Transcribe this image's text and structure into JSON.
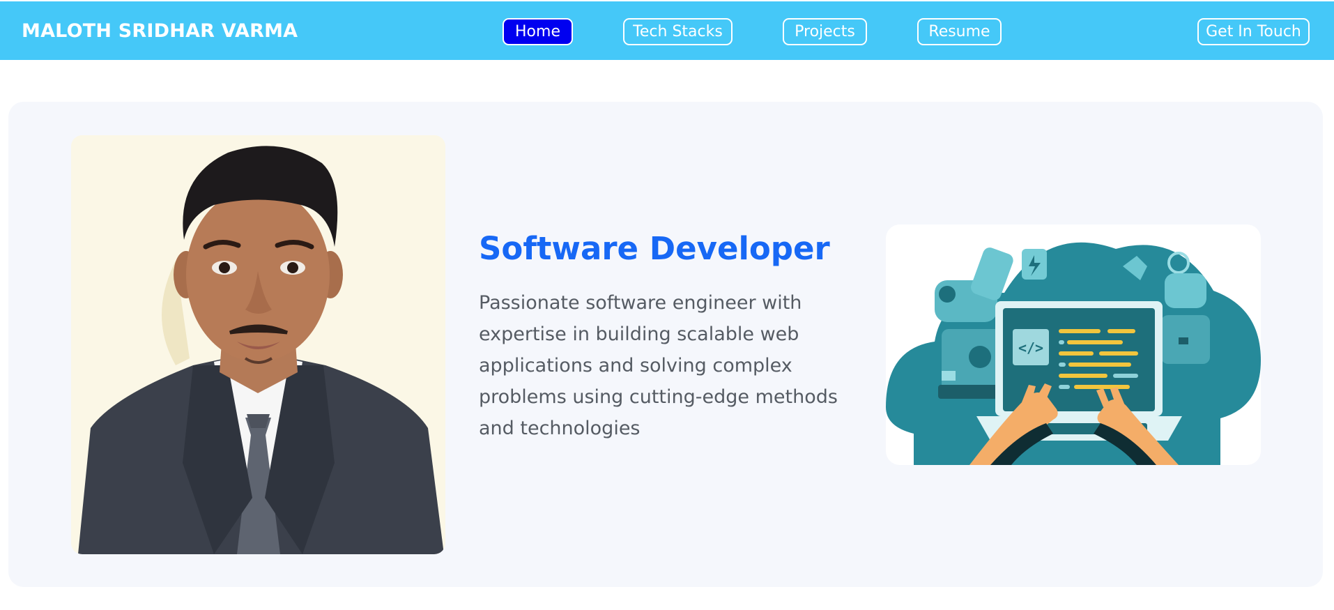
{
  "navbar": {
    "brand": "MALOTH SRIDHAR VARMA",
    "links": [
      {
        "label": "Home",
        "active": true
      },
      {
        "label": "Tech Stacks",
        "active": false
      },
      {
        "label": "Projects",
        "active": false
      },
      {
        "label": "Resume",
        "active": false
      }
    ],
    "cta_label": "Get In Touch"
  },
  "hero": {
    "title": "Software Developer",
    "description": "Passionate software engineer with expertise in building scalable web applications and solving complex problems using cutting-edge methods and technologies",
    "illustration_code_label": "</>"
  },
  "colors": {
    "navbar": "#45c8f8",
    "active_button": "#0000f0",
    "title": "#1768f5",
    "hero_background": "#f5f7fc",
    "illustration_teal": "#268a9a"
  },
  "icons": {
    "photo": "profile-photo",
    "illustration": "developer-laptop-robot-illustration"
  }
}
